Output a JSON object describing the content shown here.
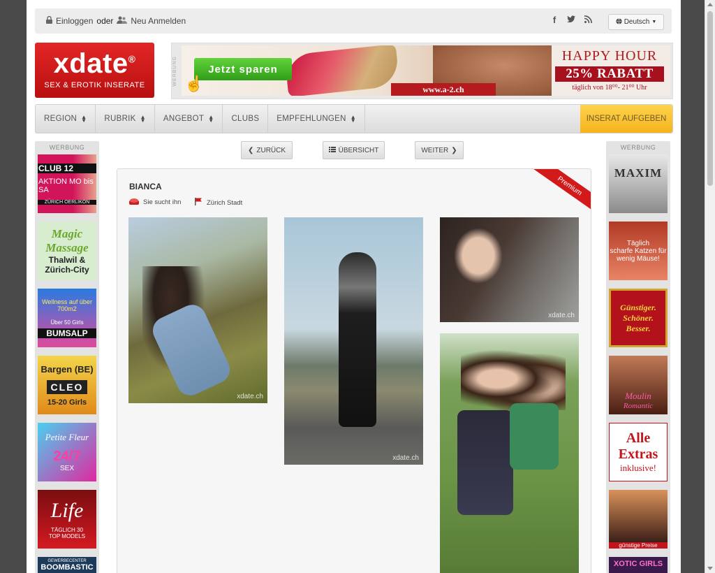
{
  "topbar": {
    "login_label": "Einloggen",
    "or_label": "oder",
    "register_label": "Neu Anmelden",
    "social_icons": [
      "facebook-icon",
      "twitter-icon",
      "rss-icon"
    ],
    "language": "Deutsch"
  },
  "logo": {
    "brand": "xdate",
    "registered": "®",
    "tagline": "SEX & EROTIK INSERATE"
  },
  "banner": {
    "label": "WERBUNG",
    "cta": "Jetzt sparen",
    "url": "www.a-2.ch",
    "happy_hour": "HAPPY HOUR",
    "discount": "25% RABATT",
    "schedule": "täglich von 18⁰⁰- 21⁰⁰ Uhr"
  },
  "nav": {
    "items": [
      {
        "label": "REGION",
        "dropdown": true
      },
      {
        "label": "RUBRIK",
        "dropdown": true
      },
      {
        "label": "ANGEBOT",
        "dropdown": true
      },
      {
        "label": "CLUBS",
        "dropdown": false
      },
      {
        "label": "EMPFEHLUNGEN",
        "dropdown": true
      }
    ],
    "cta": "INSERAT AUFGEBEN"
  },
  "sidebar_left": {
    "label": "WERBUNG",
    "ads": [
      {
        "line1": "CLUB 12",
        "line2": "AKTION MO bis SA",
        "line3": "ZÜRICH OERLIKON"
      },
      {
        "line1": "Magic Massage",
        "line2": "Thalwil &",
        "line3": "Zürich-City"
      },
      {
        "line1": "Wellness auf über 700m2",
        "line2": "Über 50 Girls",
        "line3": "BUMSALP"
      },
      {
        "line1": "Bargen (BE)",
        "line2": "CLEO",
        "line3": "15-20 Girls"
      },
      {
        "line1": "Petite Fleur",
        "line2": "24/7",
        "line3": "SEX"
      },
      {
        "line1": "Life",
        "line2": "TÄGLICH 30",
        "line3": "TOP MODELS"
      },
      {
        "line1": "GEWERBECENTER",
        "line2": "BOOMBASTIC",
        "line3": ""
      }
    ]
  },
  "sidebar_right": {
    "label": "WERBUNG",
    "ads": [
      {
        "line1": "MAXIM",
        "line2": "",
        "line3": ""
      },
      {
        "line1": "Täglich",
        "line2": "scharfe Katzen für",
        "line3": "wenig Mäuse!"
      },
      {
        "line1": "Günstiger.",
        "line2": "Schöner.",
        "line3": "Besser."
      },
      {
        "line1": "",
        "line2": "Moulin",
        "line3": "Romantic"
      },
      {
        "line1": "Alle",
        "line2": "Extras",
        "line3": "inklusive!"
      },
      {
        "line1": "",
        "line2": "",
        "line3": "günstige Preise"
      },
      {
        "line1": "XOTIC GIRLS",
        "line2": "",
        "line3": ""
      }
    ]
  },
  "pager": {
    "back": "ZURÜCK",
    "overview": "ÜBERSICHT",
    "next": "WEITER"
  },
  "listing": {
    "name": "BIANCA",
    "badge": "Premium",
    "seeking": "Sie sucht ihn",
    "location": "Zürich Stadt",
    "watermark": "xdate.ch"
  },
  "colors": {
    "brand_red": "#d21a1a",
    "cta_yellow": "#f5b31d",
    "nav_bg": "#e6e6e6"
  }
}
